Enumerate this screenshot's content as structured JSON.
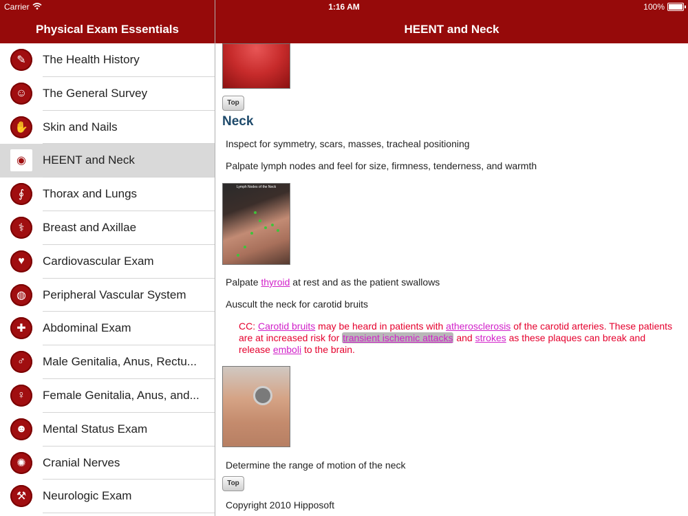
{
  "status": {
    "carrier": "Carrier",
    "time": "1:16 AM",
    "battery": "100%"
  },
  "nav": {
    "left_title": "Physical Exam Essentials",
    "right_title": "HEENT and Neck"
  },
  "sidebar": {
    "items": [
      {
        "label": "The Health History",
        "icon": "history-icon",
        "glyph": "✎"
      },
      {
        "label": "The General Survey",
        "icon": "doctor-icon",
        "glyph": "☺"
      },
      {
        "label": "Skin and Nails",
        "icon": "hand-icon",
        "glyph": "✋"
      },
      {
        "label": "HEENT and Neck",
        "icon": "eye-icon",
        "glyph": "◉"
      },
      {
        "label": "Thorax and Lungs",
        "icon": "stethoscope-icon",
        "glyph": "∮"
      },
      {
        "label": "Breast and Axillae",
        "icon": "caduceus-icon",
        "glyph": "⚕"
      },
      {
        "label": "Cardiovascular Exam",
        "icon": "heartbeat-icon",
        "glyph": "♥"
      },
      {
        "label": "Peripheral Vascular System",
        "icon": "bp-cuff-icon",
        "glyph": "◍"
      },
      {
        "label": "Abdominal Exam",
        "icon": "pills-icon",
        "glyph": "✚"
      },
      {
        "label": "Male Genitalia, Anus, Rectu...",
        "icon": "male-icon",
        "glyph": "♂"
      },
      {
        "label": "Female Genitalia, Anus, and...",
        "icon": "female-icon",
        "glyph": "♀"
      },
      {
        "label": "Mental Status Exam",
        "icon": "head-icon",
        "glyph": "☻"
      },
      {
        "label": "Cranial Nerves",
        "icon": "brain-icon",
        "glyph": "✺"
      },
      {
        "label": "Neurologic Exam",
        "icon": "reflex-icon",
        "glyph": "⚒"
      }
    ],
    "selected_index": 3
  },
  "content": {
    "top_button": "Top",
    "heading": "Neck",
    "p1": "Inspect for symmetry, scars, masses, tracheal positioning",
    "p2": "Palpate lymph nodes and feel for size, firmness, tenderness, and warmth",
    "lymph_title": "Lymph Nodes of the Neck",
    "p3_pre": "Palpate ",
    "p3_link": "thyroid",
    "p3_post": " at rest and as the patient swallows",
    "p4": "Auscult the neck for carotid bruits",
    "cc": {
      "t1": "CC: ",
      "l1": "Carotid bruits",
      "t2": " may be heard in patients with ",
      "l2": "atherosclerosis",
      "t3": " of the carotid arteries.  These patients are at increased risk for ",
      "l3": "transient ischemic attacks",
      "t4": " and ",
      "l4": "strokes",
      "t5": " as these plaques can break and release ",
      "l5": "emboli",
      "t6": " to the brain."
    },
    "p5": "Determine the range of motion of the neck",
    "copyright": "Copyright 2010 Hipposoft"
  }
}
